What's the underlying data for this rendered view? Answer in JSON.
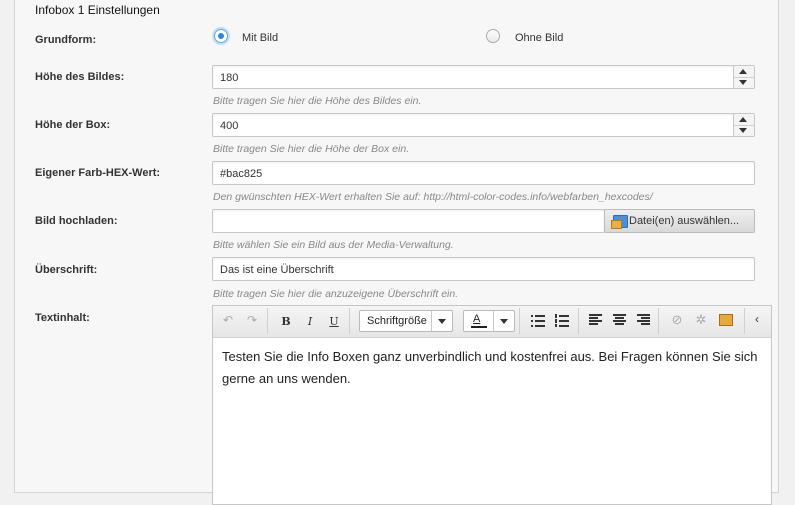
{
  "section": {
    "title": "Infobox 1 Einstellungen"
  },
  "grundform": {
    "label": "Grundform:",
    "options": [
      {
        "label": "Mit Bild",
        "selected": true
      },
      {
        "label": "Ohne Bild",
        "selected": false
      }
    ]
  },
  "hoehe_bild": {
    "label": "Höhe des Bildes:",
    "value": "180",
    "hint": "Bitte tragen Sie hier die Höhe des Bildes ein."
  },
  "hoehe_box": {
    "label": "Höhe der Box:",
    "value": "400",
    "hint": "Bitte tragen Sie hier die Höhe der Box ein."
  },
  "farbe": {
    "label": "Eigener Farb-HEX-Wert:",
    "value": "#bac825",
    "hint": "Den gwünschten HEX-Wert erhalten Sie auf: http://html-color-codes.info/webfarben_hexcodes/"
  },
  "bild": {
    "label": "Bild hochladen:",
    "value": "",
    "button_label": "Datei(en) auswählen...",
    "hint": "Bitte wählen Sie ein Bild aus der Media-Verwaltung."
  },
  "ueberschrift": {
    "label": "Überschrift:",
    "value": "Das ist eine Überschrift",
    "hint": "Bitte tragen Sie hier die anzuzeigene Überschrift ein."
  },
  "textinhalt": {
    "label": "Textinhalt:",
    "toolbar": {
      "undo_icon": "↶",
      "redo_icon": "↷",
      "bold_label": "B",
      "italic_label": "I",
      "underline_label": "U",
      "font_size_label": "Schriftgröße",
      "font_color_label": "A",
      "font_color": "#222222"
    },
    "content": "Testen Sie die Info Boxen ganz unverbindlich und kostenfrei aus. Bei Fragen können Sie sich gerne an uns wenden."
  }
}
